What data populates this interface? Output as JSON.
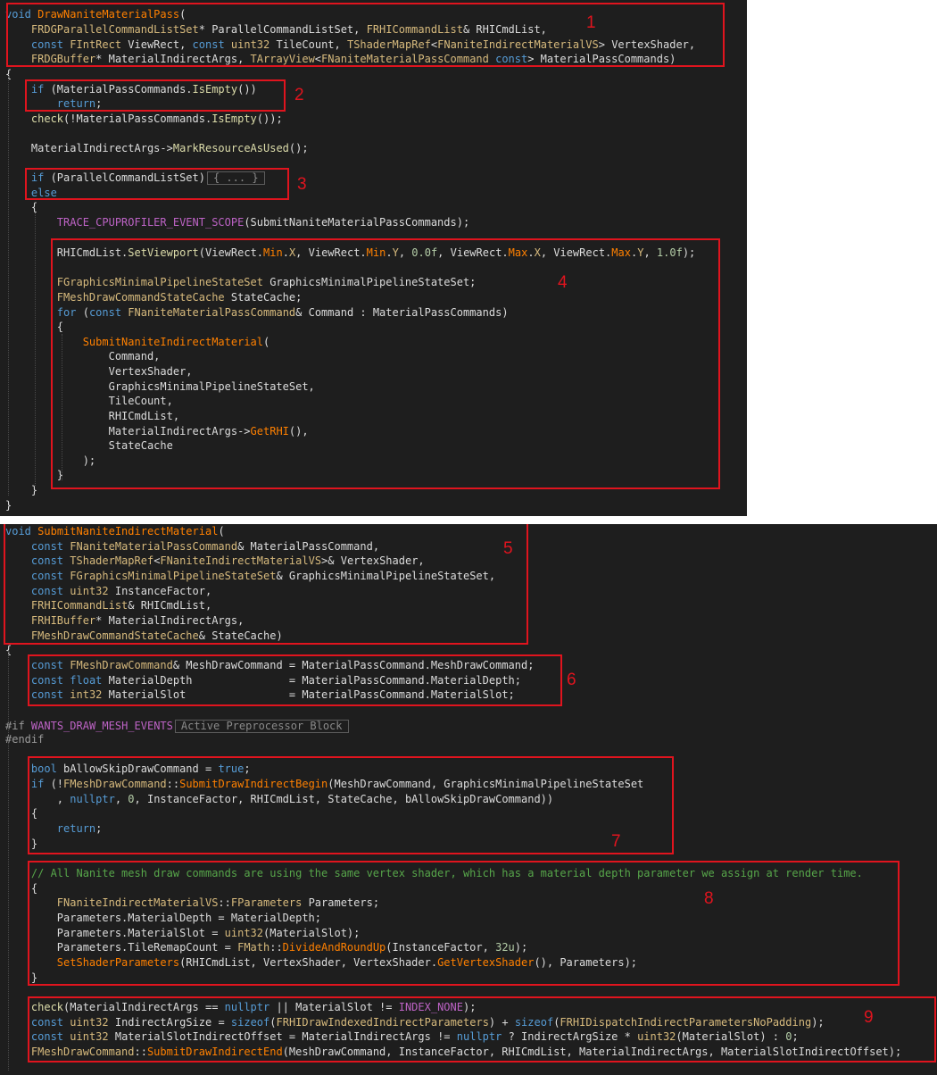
{
  "panel_top": {
    "lines": [
      [
        [
          "k",
          "void"
        ],
        [
          "p",
          " "
        ],
        [
          "fn",
          "DrawNaniteMaterialPass"
        ],
        [
          "p",
          "("
        ]
      ],
      [
        [
          "p",
          "    "
        ],
        [
          "c",
          "FRDGParallelCommandListSet"
        ],
        [
          "p",
          "* ParallelCommandListSet, "
        ],
        [
          "c",
          "FRHICommandList"
        ],
        [
          "p",
          "& RHICmdList,"
        ]
      ],
      [
        [
          "p",
          "    "
        ],
        [
          "k",
          "const"
        ],
        [
          "p",
          " "
        ],
        [
          "c",
          "FIntRect"
        ],
        [
          "p",
          " ViewRect, "
        ],
        [
          "k",
          "const"
        ],
        [
          "p",
          " "
        ],
        [
          "c",
          "uint32"
        ],
        [
          "p",
          " TileCount, "
        ],
        [
          "c",
          "TShaderMapRef"
        ],
        [
          "p",
          "<"
        ],
        [
          "c",
          "FNaniteIndirectMaterialVS"
        ],
        [
          "p",
          "> VertexShader,"
        ]
      ],
      [
        [
          "p",
          "    "
        ],
        [
          "c",
          "FRDGBuffer"
        ],
        [
          "p",
          "* MaterialIndirectArgs, "
        ],
        [
          "c",
          "TArrayView"
        ],
        [
          "p",
          "<"
        ],
        [
          "c",
          "FNaniteMaterialPassCommand"
        ],
        [
          "p",
          " "
        ],
        [
          "k",
          "const"
        ],
        [
          "p",
          "> MaterialPassCommands)"
        ]
      ],
      [
        [
          "p",
          "{"
        ]
      ],
      [
        [
          "p",
          "    "
        ],
        [
          "k",
          "if"
        ],
        [
          "p",
          " (MaterialPassCommands."
        ],
        [
          "f",
          "IsEmpty"
        ],
        [
          "p",
          "())"
        ]
      ],
      [
        [
          "p",
          "        "
        ],
        [
          "k",
          "return"
        ],
        [
          "p",
          ";"
        ]
      ],
      [
        [
          "p",
          "    "
        ],
        [
          "f",
          "check"
        ],
        [
          "p",
          "(!MaterialPassCommands."
        ],
        [
          "f",
          "IsEmpty"
        ],
        [
          "p",
          "());"
        ]
      ],
      [
        [
          "p",
          ""
        ]
      ],
      [
        [
          "p",
          "    MaterialIndirectArgs->"
        ],
        [
          "f",
          "MarkResourceAsUsed"
        ],
        [
          "p",
          "();"
        ]
      ],
      [
        [
          "p",
          ""
        ]
      ],
      [
        [
          "p",
          "    "
        ],
        [
          "k",
          "if"
        ],
        [
          "p",
          " (ParallelCommandListSet)"
        ],
        [
          "fold",
          "{ ... }"
        ]
      ],
      [
        [
          "p",
          "    "
        ],
        [
          "k",
          "else"
        ]
      ],
      [
        [
          "p",
          "    {"
        ]
      ],
      [
        [
          "p",
          "        "
        ],
        [
          "m",
          "TRACE_CPUPROFILER_EVENT_SCOPE"
        ],
        [
          "p",
          "(SubmitNaniteMaterialPassCommands);"
        ]
      ],
      [
        [
          "p",
          ""
        ]
      ],
      [
        [
          "p",
          "        RHICmdList."
        ],
        [
          "f",
          "SetViewport"
        ],
        [
          "p",
          "(ViewRect."
        ],
        [
          "fn",
          "Min"
        ],
        [
          "p",
          "."
        ],
        [
          "c",
          "X"
        ],
        [
          "p",
          ", ViewRect."
        ],
        [
          "fn",
          "Min"
        ],
        [
          "p",
          "."
        ],
        [
          "c",
          "Y"
        ],
        [
          "p",
          ", "
        ],
        [
          "n",
          "0.0f"
        ],
        [
          "p",
          ", ViewRect."
        ],
        [
          "fn",
          "Max"
        ],
        [
          "p",
          "."
        ],
        [
          "c",
          "X"
        ],
        [
          "p",
          ", ViewRect."
        ],
        [
          "fn",
          "Max"
        ],
        [
          "p",
          "."
        ],
        [
          "c",
          "Y"
        ],
        [
          "p",
          ", "
        ],
        [
          "n",
          "1.0f"
        ],
        [
          "p",
          ");"
        ]
      ],
      [
        [
          "p",
          ""
        ]
      ],
      [
        [
          "p",
          "        "
        ],
        [
          "c",
          "FGraphicsMinimalPipelineStateSet"
        ],
        [
          "p",
          " GraphicsMinimalPipelineStateSet;"
        ]
      ],
      [
        [
          "p",
          "        "
        ],
        [
          "c",
          "FMeshDrawCommandStateCache"
        ],
        [
          "p",
          " StateCache;"
        ]
      ],
      [
        [
          "p",
          "        "
        ],
        [
          "k",
          "for"
        ],
        [
          "p",
          " ("
        ],
        [
          "k",
          "const"
        ],
        [
          "p",
          " "
        ],
        [
          "c",
          "FNaniteMaterialPassCommand"
        ],
        [
          "p",
          "& Command : MaterialPassCommands)"
        ]
      ],
      [
        [
          "p",
          "        {"
        ]
      ],
      [
        [
          "p",
          "            "
        ],
        [
          "fn",
          "SubmitNaniteIndirectMaterial"
        ],
        [
          "p",
          "("
        ]
      ],
      [
        [
          "p",
          "                Command,"
        ]
      ],
      [
        [
          "p",
          "                VertexShader,"
        ]
      ],
      [
        [
          "p",
          "                GraphicsMinimalPipelineStateSet,"
        ]
      ],
      [
        [
          "p",
          "                TileCount,"
        ]
      ],
      [
        [
          "p",
          "                RHICmdList,"
        ]
      ],
      [
        [
          "p",
          "                MaterialIndirectArgs->"
        ],
        [
          "fn",
          "GetRHI"
        ],
        [
          "p",
          "(),"
        ]
      ],
      [
        [
          "p",
          "                StateCache"
        ]
      ],
      [
        [
          "p",
          "            );"
        ]
      ],
      [
        [
          "p",
          "        }"
        ]
      ],
      [
        [
          "p",
          "    }"
        ]
      ],
      [
        [
          "p",
          "}"
        ]
      ]
    ]
  },
  "panel_bottom": {
    "lines": [
      [
        [
          "k",
          "void"
        ],
        [
          "p",
          " "
        ],
        [
          "fn",
          "SubmitNaniteIndirectMaterial"
        ],
        [
          "p",
          "("
        ]
      ],
      [
        [
          "p",
          "    "
        ],
        [
          "k",
          "const"
        ],
        [
          "p",
          " "
        ],
        [
          "c",
          "FNaniteMaterialPassCommand"
        ],
        [
          "p",
          "& MaterialPassCommand,"
        ]
      ],
      [
        [
          "p",
          "    "
        ],
        [
          "k",
          "const"
        ],
        [
          "p",
          " "
        ],
        [
          "c",
          "TShaderMapRef"
        ],
        [
          "p",
          "<"
        ],
        [
          "c",
          "FNaniteIndirectMaterialVS"
        ],
        [
          "p",
          ">& VertexShader,"
        ]
      ],
      [
        [
          "p",
          "    "
        ],
        [
          "k",
          "const"
        ],
        [
          "p",
          " "
        ],
        [
          "c",
          "FGraphicsMinimalPipelineStateSet"
        ],
        [
          "p",
          "& GraphicsMinimalPipelineStateSet,"
        ]
      ],
      [
        [
          "p",
          "    "
        ],
        [
          "k",
          "const"
        ],
        [
          "p",
          " "
        ],
        [
          "c",
          "uint32"
        ],
        [
          "p",
          " InstanceFactor,"
        ]
      ],
      [
        [
          "p",
          "    "
        ],
        [
          "c",
          "FRHICommandList"
        ],
        [
          "p",
          "& RHICmdList,"
        ]
      ],
      [
        [
          "p",
          "    "
        ],
        [
          "c",
          "FRHIBuffer"
        ],
        [
          "p",
          "* MaterialIndirectArgs,"
        ]
      ],
      [
        [
          "p",
          "    "
        ],
        [
          "c",
          "FMeshDrawCommandStateCache"
        ],
        [
          "p",
          "& StateCache)"
        ]
      ],
      [
        [
          "p",
          "{"
        ]
      ],
      [
        [
          "p",
          "    "
        ],
        [
          "k",
          "const"
        ],
        [
          "p",
          " "
        ],
        [
          "c",
          "FMeshDrawCommand"
        ],
        [
          "p",
          "& MeshDrawCommand = MaterialPassCommand.MeshDrawCommand;"
        ]
      ],
      [
        [
          "p",
          "    "
        ],
        [
          "k",
          "const"
        ],
        [
          "p",
          " "
        ],
        [
          "k",
          "float"
        ],
        [
          "p",
          " MaterialDepth               = MaterialPassCommand.MaterialDepth;"
        ]
      ],
      [
        [
          "p",
          "    "
        ],
        [
          "k",
          "const"
        ],
        [
          "p",
          " "
        ],
        [
          "c",
          "int32"
        ],
        [
          "p",
          " MaterialSlot                = MaterialPassCommand.MaterialSlot;"
        ]
      ],
      [
        [
          "p",
          ""
        ]
      ],
      [
        [
          "pp",
          "#if"
        ],
        [
          "p",
          " "
        ],
        [
          "m",
          "WANTS_DRAW_MESH_EVENTS"
        ],
        [
          "fold",
          "Active Preprocessor Block"
        ]
      ],
      [
        [
          "pp",
          "#endif"
        ]
      ],
      [
        [
          "p",
          ""
        ]
      ],
      [
        [
          "p",
          "    "
        ],
        [
          "k",
          "bool"
        ],
        [
          "p",
          " bAllowSkipDrawCommand = "
        ],
        [
          "k",
          "true"
        ],
        [
          "p",
          ";"
        ]
      ],
      [
        [
          "p",
          "    "
        ],
        [
          "k",
          "if"
        ],
        [
          "p",
          " (!"
        ],
        [
          "c",
          "FMeshDrawCommand"
        ],
        [
          "p",
          "::"
        ],
        [
          "fn",
          "SubmitDrawIndirectBegin"
        ],
        [
          "p",
          "(MeshDrawCommand, GraphicsMinimalPipelineStateSet"
        ]
      ],
      [
        [
          "p",
          "        , "
        ],
        [
          "k",
          "nullptr"
        ],
        [
          "p",
          ", "
        ],
        [
          "n",
          "0"
        ],
        [
          "p",
          ", InstanceFactor, RHICmdList, StateCache, bAllowSkipDrawCommand))"
        ]
      ],
      [
        [
          "p",
          "    {"
        ]
      ],
      [
        [
          "p",
          "        "
        ],
        [
          "k",
          "return"
        ],
        [
          "p",
          ";"
        ]
      ],
      [
        [
          "p",
          "    }"
        ]
      ],
      [
        [
          "p",
          ""
        ]
      ],
      [
        [
          "p",
          "    "
        ],
        [
          "cm",
          "// All Nanite mesh draw commands are using the same vertex shader, which has a material depth parameter we assign at render time."
        ]
      ],
      [
        [
          "p",
          "    {"
        ]
      ],
      [
        [
          "p",
          "        "
        ],
        [
          "c",
          "FNaniteIndirectMaterialVS"
        ],
        [
          "p",
          "::"
        ],
        [
          "c",
          "FParameters"
        ],
        [
          "p",
          " Parameters;"
        ]
      ],
      [
        [
          "p",
          "        Parameters.MaterialDepth = MaterialDepth;"
        ]
      ],
      [
        [
          "p",
          "        Parameters.MaterialSlot = "
        ],
        [
          "c",
          "uint32"
        ],
        [
          "p",
          "(MaterialSlot);"
        ]
      ],
      [
        [
          "p",
          "        Parameters.TileRemapCount = "
        ],
        [
          "c",
          "FMath"
        ],
        [
          "p",
          "::"
        ],
        [
          "fn",
          "DivideAndRoundUp"
        ],
        [
          "p",
          "(InstanceFactor, "
        ],
        [
          "n",
          "32u"
        ],
        [
          "p",
          ");"
        ]
      ],
      [
        [
          "p",
          "        "
        ],
        [
          "fn",
          "SetShaderParameters"
        ],
        [
          "p",
          "(RHICmdList, VertexShader, VertexShader."
        ],
        [
          "fn",
          "GetVertexShader"
        ],
        [
          "p",
          "(), Parameters);"
        ]
      ],
      [
        [
          "p",
          "    }"
        ]
      ],
      [
        [
          "p",
          ""
        ]
      ],
      [
        [
          "p",
          "    "
        ],
        [
          "f",
          "check"
        ],
        [
          "p",
          "(MaterialIndirectArgs == "
        ],
        [
          "k",
          "nullptr"
        ],
        [
          "p",
          " || MaterialSlot != "
        ],
        [
          "m",
          "INDEX_NONE"
        ],
        [
          "p",
          ");"
        ]
      ],
      [
        [
          "p",
          "    "
        ],
        [
          "k",
          "const"
        ],
        [
          "p",
          " "
        ],
        [
          "c",
          "uint32"
        ],
        [
          "p",
          " IndirectArgSize = "
        ],
        [
          "k",
          "sizeof"
        ],
        [
          "p",
          "("
        ],
        [
          "c",
          "FRHIDrawIndexedIndirectParameters"
        ],
        [
          "p",
          ") + "
        ],
        [
          "k",
          "sizeof"
        ],
        [
          "p",
          "("
        ],
        [
          "c",
          "FRHIDispatchIndirectParametersNoPadding"
        ],
        [
          "p",
          ");"
        ]
      ],
      [
        [
          "p",
          "    "
        ],
        [
          "k",
          "const"
        ],
        [
          "p",
          " "
        ],
        [
          "c",
          "uint32"
        ],
        [
          "p",
          " MaterialSlotIndirectOffset = MaterialIndirectArgs != "
        ],
        [
          "k",
          "nullptr"
        ],
        [
          "p",
          " ? IndirectArgSize * "
        ],
        [
          "c",
          "uint32"
        ],
        [
          "p",
          "(MaterialSlot) : "
        ],
        [
          "n",
          "0"
        ],
        [
          "p",
          ";"
        ]
      ],
      [
        [
          "p",
          "    "
        ],
        [
          "c",
          "FMeshDrawCommand"
        ],
        [
          "p",
          "::"
        ],
        [
          "fn",
          "SubmitDrawIndirectEnd"
        ],
        [
          "p",
          "(MeshDrawCommand, InstanceFactor, RHICmdList, MaterialIndirectArgs, MaterialSlotIndirectOffset);"
        ]
      ]
    ]
  },
  "annotations": [
    "1",
    "2",
    "3",
    "4",
    "5",
    "6",
    "7",
    "8",
    "9"
  ],
  "colors": {
    "annotation": "#e0141e",
    "background": "#1e1e1e",
    "keyword": "#569cd6",
    "type": "#d7ba7d",
    "function": "#ff8000",
    "macro": "#bd63c5",
    "comment": "#57a64a"
  }
}
